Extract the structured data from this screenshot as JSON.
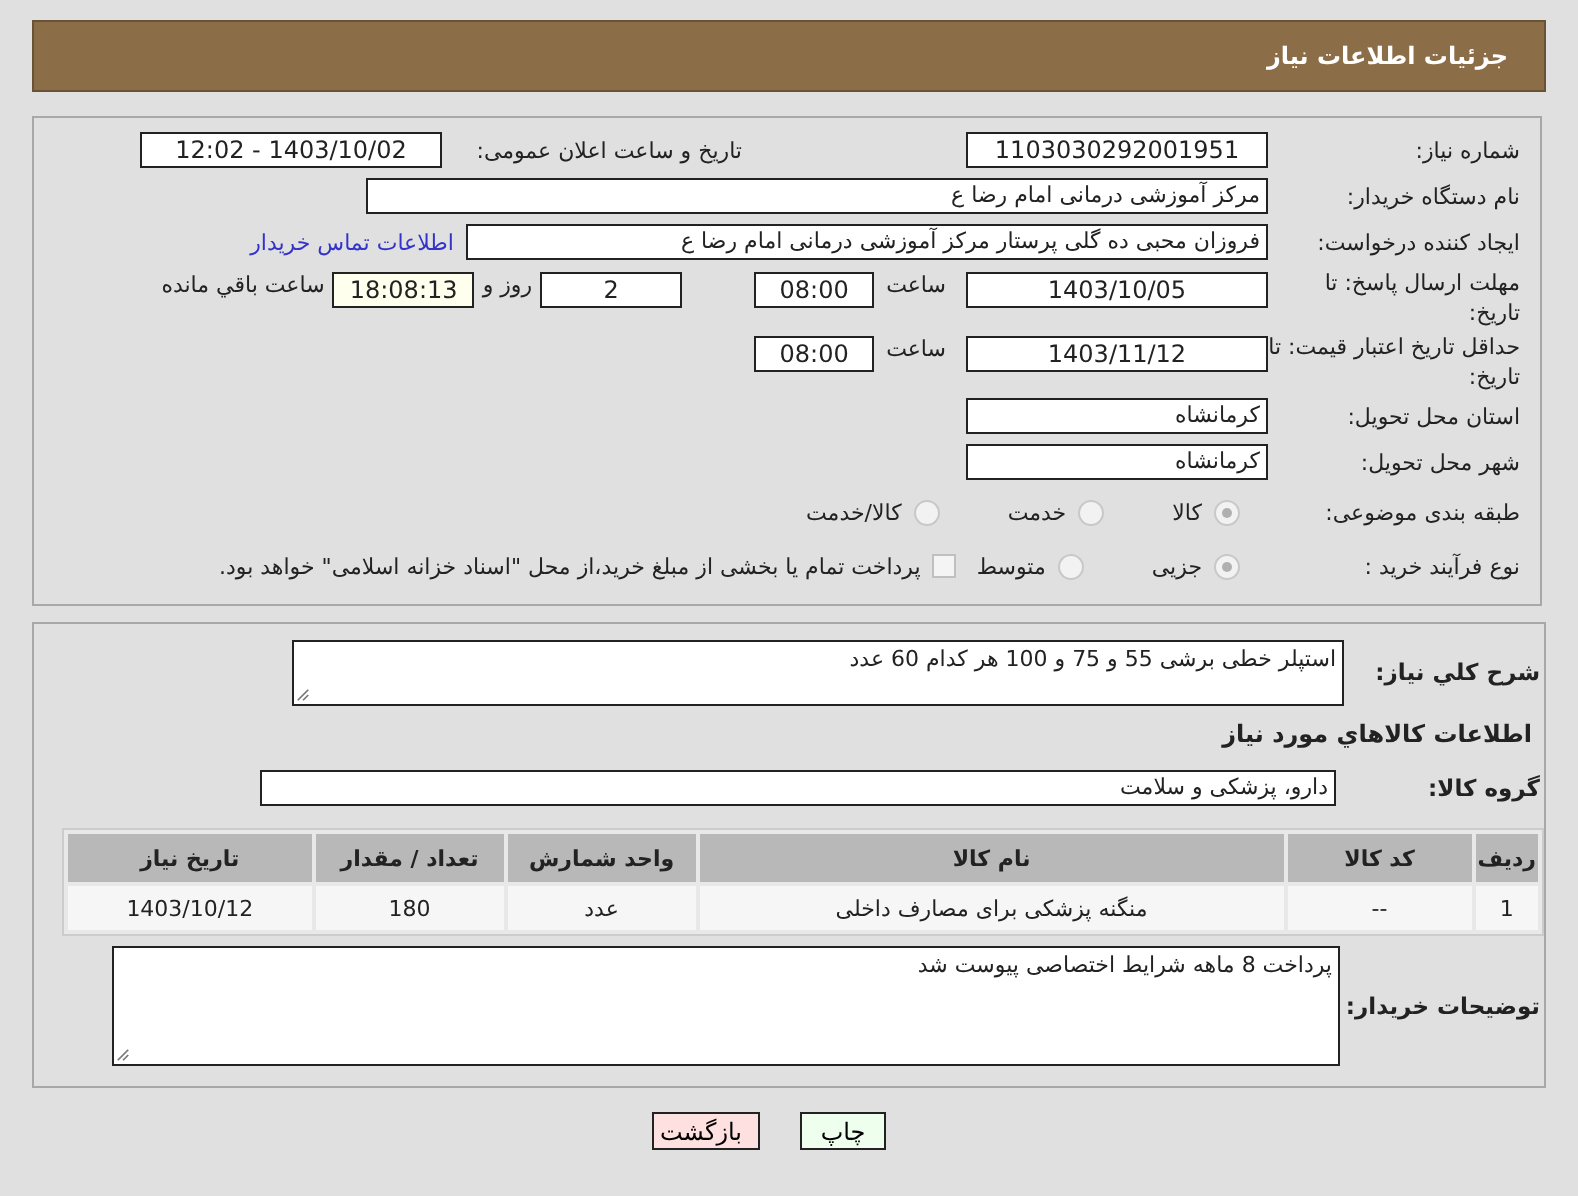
{
  "title": "جزئیات اطلاعات نیاز",
  "need_number": {
    "label": "شماره نیاز:",
    "value": "1103030292001951"
  },
  "announce": {
    "label": "تاریخ و ساعت اعلان عمومی:",
    "value": "1403/10/02 - 12:02"
  },
  "buyer": {
    "label": "نام دستگاه خریدار:",
    "value": "مرکز آموزشی  درمانی امام رضا  ع"
  },
  "creator": {
    "label": "ایجاد کننده درخواست:",
    "value": "فروزان محبی ده گلی پرستار مرکز آموزشی  درمانی امام رضا  ع",
    "link": "اطلاعات تماس خریدار"
  },
  "deadline": {
    "label": "مهلت ارسال پاسخ: تا تاریخ:",
    "date": "1403/10/05",
    "time_label": "ساعت",
    "time": "08:00",
    "days": "2",
    "days_label": "روز و",
    "remaining": "18:08:13",
    "remaining_label": "ساعت باقي مانده"
  },
  "validity": {
    "label": "حداقل تاریخ اعتبار قیمت: تا تاریخ:",
    "date": "1403/11/12",
    "time_label": "ساعت",
    "time": "08:00"
  },
  "province": {
    "label": "استان محل تحویل:",
    "value": "کرمانشاه"
  },
  "city": {
    "label": "شهر محل تحویل:",
    "value": "کرمانشاه"
  },
  "category": {
    "label": "طبقه بندی موضوعی:",
    "options": [
      {
        "label": "کالا",
        "selected": true
      },
      {
        "label": "خدمت",
        "selected": false
      },
      {
        "label": "کالا/خدمت",
        "selected": false
      }
    ]
  },
  "process": {
    "label": "نوع فرآیند خرید :",
    "options": [
      {
        "label": "جزیی",
        "selected": true
      },
      {
        "label": "متوسط",
        "selected": false
      }
    ],
    "checkbox": {
      "label": "پرداخت تمام یا بخشی از مبلغ خرید،از محل \"اسناد خزانه اسلامی\" خواهد بود.",
      "checked": false
    }
  },
  "description": {
    "label": "شرح کلي نياز:",
    "value": "استپلر  خطی برشی   55 و 75 و 100   هر کدام 60 عدد"
  },
  "goods_heading": "اطلاعات کالاهاي مورد نياز",
  "group": {
    "label": "گروه کالا:",
    "value": "دارو، پزشکی و سلامت"
  },
  "table": {
    "columns": [
      "رديف",
      "کد کالا",
      "نام کالا",
      "واحد شمارش",
      "تعداد / مقدار",
      "تاریخ نیاز"
    ],
    "rows": [
      [
        "1",
        "--",
        "منگنه پزشکی برای مصارف داخلی",
        "عدد",
        "180",
        "1403/10/12"
      ]
    ]
  },
  "buyer_notes": {
    "label": "توضیحات خریدار:",
    "value": "پرداخت  8 ماهه  شرایط اختصاصی پیوست شد"
  },
  "buttons": [
    {
      "label": "چاپ",
      "kind": "print"
    },
    {
      "label": "بازگشت",
      "kind": "back"
    }
  ]
}
